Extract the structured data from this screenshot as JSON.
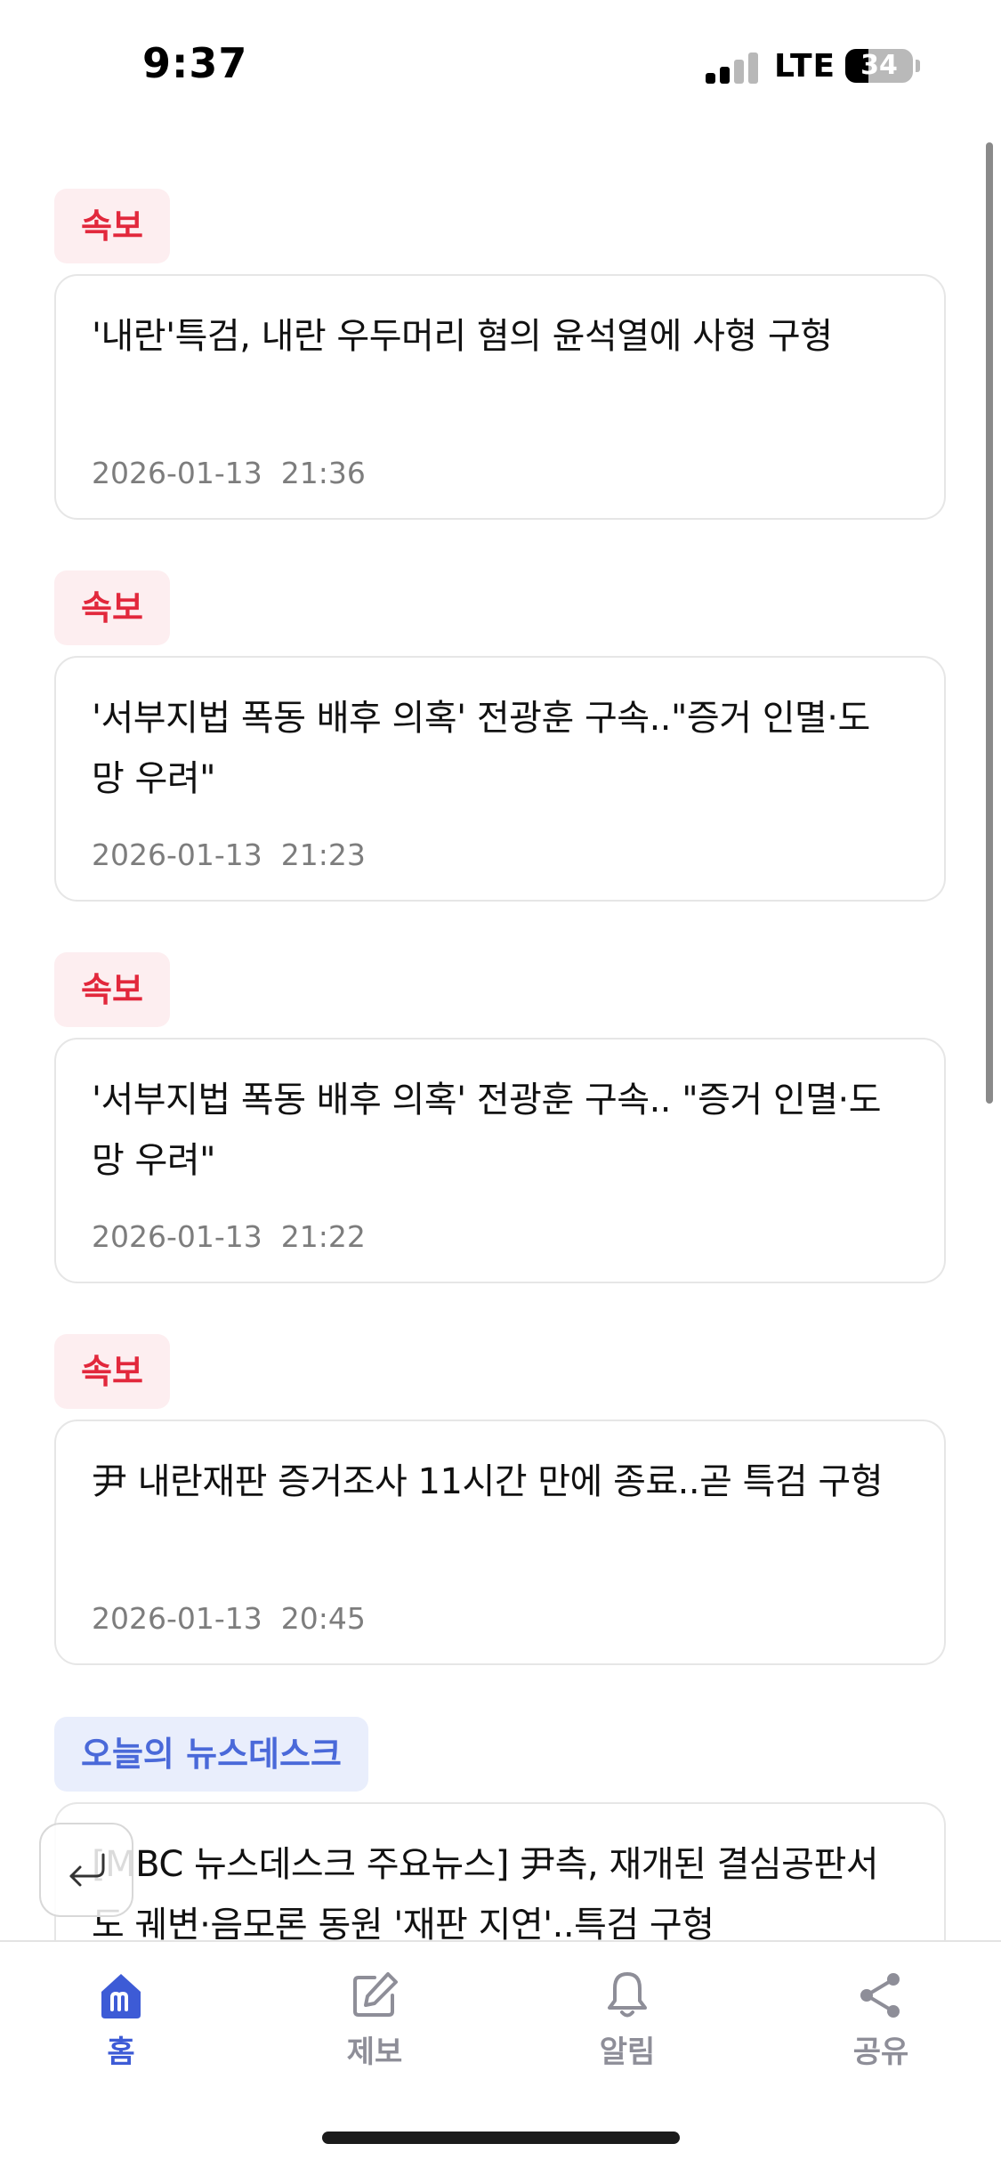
{
  "status_bar": {
    "time": "9:37",
    "network": "LTE",
    "battery": "34",
    "battery_percent": 34
  },
  "feed": {
    "items": [
      {
        "tag": "속보",
        "title": "'내란'특검, 내란 우두머리 혐의 윤석열에 사형 구형",
        "date": "2026-01-13  21:36"
      },
      {
        "tag": "속보",
        "title": "'서부지법 폭동 배후 의혹' 전광훈 구속..\"증거 인멸·도망 우려\"",
        "date": "2026-01-13  21:23"
      },
      {
        "tag": "속보",
        "title": "'서부지법 폭동 배후 의혹' 전광훈 구속.. \"증거 인멸·도망 우려\"",
        "date": "2026-01-13  21:22"
      },
      {
        "tag": "속보",
        "title": "尹 내란재판 증거조사 11시간 만에 종료..곧 특검 구형",
        "date": "2026-01-13  20:45"
      },
      {
        "tag": "오늘의 뉴스데스크",
        "title": "[MBC 뉴스데스크 주요뉴스] 尹측, 재개된 결심공판서도 궤변·음모론 동원 '재판 지연'..특검 구형",
        "date": ""
      }
    ]
  },
  "bottom_nav": {
    "items": [
      {
        "label": "홈",
        "icon": "home-icon",
        "active": true
      },
      {
        "label": "제보",
        "icon": "edit-icon",
        "active": false
      },
      {
        "label": "알림",
        "icon": "bell-icon",
        "active": false
      },
      {
        "label": "공유",
        "icon": "share-icon",
        "active": false
      }
    ]
  },
  "colors": {
    "breaking_tag_text": "#e2283c",
    "breaking_tag_bg": "#fdeef0",
    "desk_tag_text": "#4a69d9",
    "desk_tag_bg": "#e9eefc",
    "nav_active": "#3d5bd6",
    "nav_inactive": "#8e8e98"
  }
}
